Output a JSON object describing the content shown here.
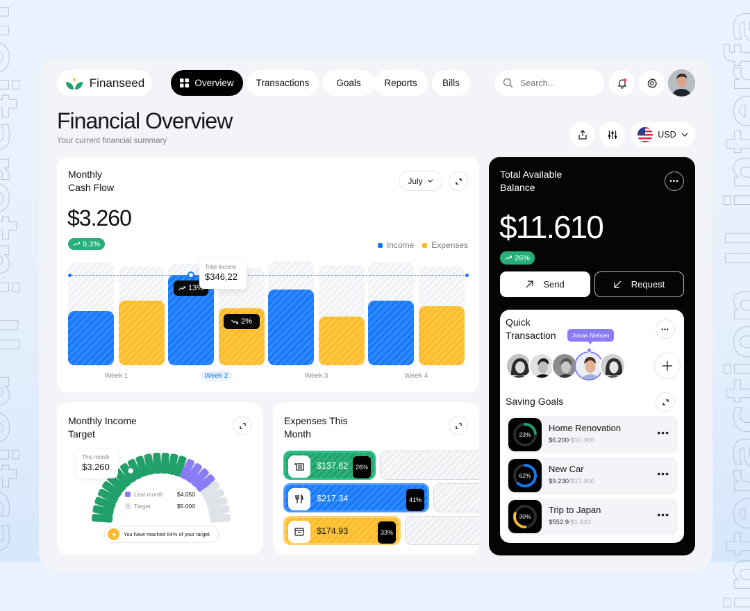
{
  "watermark": {
    "left_text": "suoitaretni Il noitca",
    "right_text": "interaction II interfa"
  },
  "header": {
    "brand": "Finanseed",
    "nav": [
      {
        "label": "Overview",
        "active": true,
        "icon": "grid-icon"
      },
      {
        "label": "Transactions",
        "active": false
      },
      {
        "label": "Goals",
        "active": false
      },
      {
        "label": "Reports",
        "active": false
      },
      {
        "label": "Bills",
        "active": false
      }
    ],
    "search_placeholder": "Search...",
    "notification_dot": true,
    "colors": {
      "accent_dark": "#000000",
      "notification": "#f0455a"
    }
  },
  "page": {
    "title": "Financial Overview",
    "subtitle": "Your current financial summary",
    "currency": "USD"
  },
  "cash_flow": {
    "title_line1": "Monthly",
    "title_line2": "Cash Flow",
    "month": "July",
    "amount": "$3.260",
    "change": "9.3%",
    "legend": [
      {
        "label": "Income",
        "color": "#1677f5"
      },
      {
        "label": "Expenses",
        "color": "#fbb92c"
      }
    ],
    "tooltip_label": "Total Income",
    "tooltip_value": "$346,22",
    "income_tag": "13%",
    "expense_tag": "2%",
    "selected_week": "Week 2"
  },
  "chart_data": {
    "type": "bar",
    "title": "Monthly Cash Flow",
    "categories": [
      "Week 1",
      "Week 2",
      "Week 3",
      "Week 4"
    ],
    "series": [
      {
        "name": "Income",
        "color": "#1677f5",
        "values": [
          209,
          346.22,
          291,
          249
        ]
      },
      {
        "name": "Expenses",
        "color": "#fbb92c",
        "values": [
          249,
          218,
          186,
          228
        ]
      }
    ],
    "ylim": [
      0,
      400
    ],
    "max_background": [
      395,
      390,
      400,
      395
    ],
    "reference_line": 346.22,
    "xlabel": "",
    "ylabel": "",
    "grid": true,
    "legend": "top-right"
  },
  "income_target": {
    "title_line1": "Monthly Income",
    "title_line2": "Target",
    "this_month_label": "This month",
    "this_month_value": "$3.260",
    "last_month_label": "Last month",
    "last_month_value": "$4.050",
    "target_label": "Target",
    "target_value": "$5.000",
    "message": "You have reached 64% of your target.",
    "progress_fraction": 0.64,
    "last_month_fraction": 0.81,
    "colors": {
      "current": "#22a06b",
      "last": "#8b7cf6",
      "target": "#dfe2e7"
    }
  },
  "expenses": {
    "title_line1": "Expenses This",
    "title_line2": "Month",
    "items": [
      {
        "icon": "receipt-icon",
        "amount": "$137.82",
        "percent": "26%",
        "fraction": 0.26,
        "color": "green"
      },
      {
        "icon": "fork-knife-icon",
        "amount": "$217.34",
        "percent": "41%",
        "fraction": 0.41,
        "color": "blue"
      },
      {
        "icon": "shopping-bag-icon",
        "amount": "$174.93",
        "percent": "33%",
        "fraction": 0.33,
        "color": "yellow"
      }
    ]
  },
  "balance": {
    "title_line1": "Total Available",
    "title_line2": "Balance",
    "amount": "$11.610",
    "change": "26%",
    "send_label": "Send",
    "request_label": "Request"
  },
  "quick_transaction": {
    "title_line1": "Quick",
    "title_line2": "Transaction",
    "selected_contact": "Jonas Nielsen",
    "contacts": [
      "Contact 1",
      "Contact 2",
      "Contact 3",
      "Jonas Nielsen",
      "Contact 5"
    ]
  },
  "saving_goals": {
    "title": "Saving Goals",
    "items": [
      {
        "name": "Home Renovation",
        "saved": "$6.200",
        "target": "/$10.000",
        "percent": "23%",
        "fraction": 0.23,
        "color": "#22a06b"
      },
      {
        "name": "New Car",
        "saved": "$9.230",
        "target": "/$13.000",
        "percent": "62%",
        "fraction": 0.62,
        "color": "#1677f5"
      },
      {
        "name": "Trip to Japan",
        "saved": "$552.9",
        "target": "/$1.843",
        "percent": "30%",
        "fraction": 0.3,
        "color": "#fbb92c"
      }
    ]
  }
}
